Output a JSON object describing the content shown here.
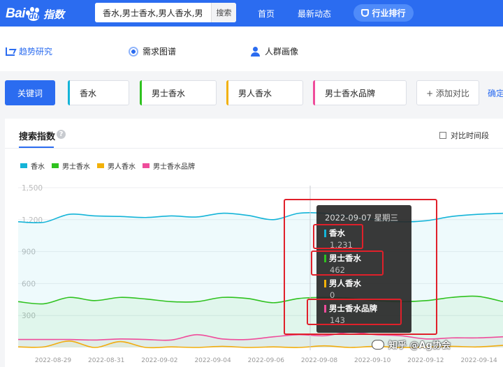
{
  "header": {
    "logo_text": "Bai",
    "logo_du": "du",
    "logo_suffix": "指数",
    "search_value": "香水,男士香水,男人香水,男",
    "search_button": "搜索",
    "nav": [
      "首页",
      "最新动态"
    ],
    "rank_button": "行业排行"
  },
  "tabs": [
    {
      "label": "趋势研究",
      "icon": "trend-icon",
      "active": true
    },
    {
      "label": "需求图谱",
      "icon": "demand-graph-icon",
      "active": false
    },
    {
      "label": "人群画像",
      "icon": "people-icon",
      "active": false
    }
  ],
  "keywords": {
    "label": "关键词",
    "items": [
      {
        "text": "香水",
        "color": "#14b4d8"
      },
      {
        "text": "男士香水",
        "color": "#2fc21f"
      },
      {
        "text": "男人香水",
        "color": "#f2b109"
      },
      {
        "text": "男士香水品牌",
        "color": "#ef4c9b"
      }
    ],
    "add_label": "+ 添加对比",
    "confirm_label": "确定"
  },
  "panel": {
    "title": "搜索指数",
    "help": "?",
    "compare_label": "对比时间段"
  },
  "chart_data": {
    "type": "area",
    "y_ticks": [
      "1,500",
      "1,200",
      "900",
      "600",
      "300"
    ],
    "ylim": [
      0,
      1500
    ],
    "x_labels": [
      "2022-08-29",
      "2022-08-31",
      "2022-09-02",
      "2022-09-04",
      "2022-09-06",
      "2022-09-08",
      "2022-09-10",
      "2022-09-12",
      "2022-09-14"
    ],
    "grid": true,
    "legend_position": "top-left",
    "series": [
      {
        "name": "香水",
        "color": "#14b4d8",
        "values": [
          1180,
          1175,
          1250,
          1235,
          1230,
          1220,
          1235,
          1225,
          1260,
          1240,
          1200,
          1260,
          1260,
          1231,
          1200,
          1180,
          1190,
          1230,
          1250,
          1260
        ]
      },
      {
        "name": "男士香水",
        "color": "#2fc21f",
        "values": [
          430,
          410,
          470,
          440,
          470,
          455,
          430,
          430,
          470,
          460,
          420,
          460,
          470,
          462,
          440,
          430,
          440,
          470,
          480,
          430
        ]
      },
      {
        "name": "男人香水",
        "color": "#f2b109",
        "values": [
          5,
          5,
          60,
          0,
          55,
          0,
          5,
          0,
          10,
          0,
          5,
          0,
          15,
          0,
          10,
          0,
          5,
          10,
          5,
          20
        ]
      },
      {
        "name": "男士香水品牌",
        "color": "#ef4c9b",
        "values": [
          75,
          75,
          75,
          70,
          80,
          75,
          70,
          120,
          80,
          75,
          100,
          120,
          110,
          143,
          120,
          110,
          80,
          90,
          90,
          100
        ]
      }
    ],
    "highlight_index": 13
  },
  "tooltip": {
    "date": "2022-09-07 星期三",
    "items": [
      {
        "name": "香水",
        "value": "1,231",
        "color": "#14b4d8"
      },
      {
        "name": "男士香水",
        "value": "462",
        "color": "#2fc21f"
      },
      {
        "name": "男人香水",
        "value": "0",
        "color": "#f2b109"
      },
      {
        "name": "男士香水品牌",
        "value": "143",
        "color": "#ef4c9b"
      }
    ]
  },
  "watermark": "知乎 @Ag协会"
}
